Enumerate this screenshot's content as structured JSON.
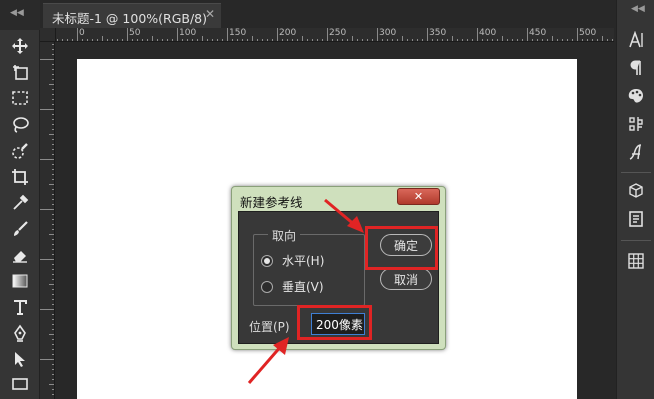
{
  "tab": {
    "title": "未标题-1 @ 100%(RGB/8)",
    "close": "✕"
  },
  "toolbar": {
    "collapse": "◀◀"
  },
  "rpanel": {
    "collapse": "◀◀"
  },
  "ruler": {
    "labels": [
      "0",
      "50",
      "100",
      "150",
      "200",
      "250",
      "300",
      "350",
      "400",
      "450",
      "500"
    ]
  },
  "dialog": {
    "title": "新建参考线",
    "close": "✕",
    "orientation_label": "取向",
    "horizontal_label": "水平(H)",
    "vertical_label": "垂直(V)",
    "selected_orientation": "horizontal",
    "ok_label": "确定",
    "cancel_label": "取消",
    "position_label": "位置(P)",
    "position_value": "200像素"
  },
  "colors": {
    "highlight": "#e02424",
    "canvas": "#ffffff",
    "workspace": "#282828"
  }
}
